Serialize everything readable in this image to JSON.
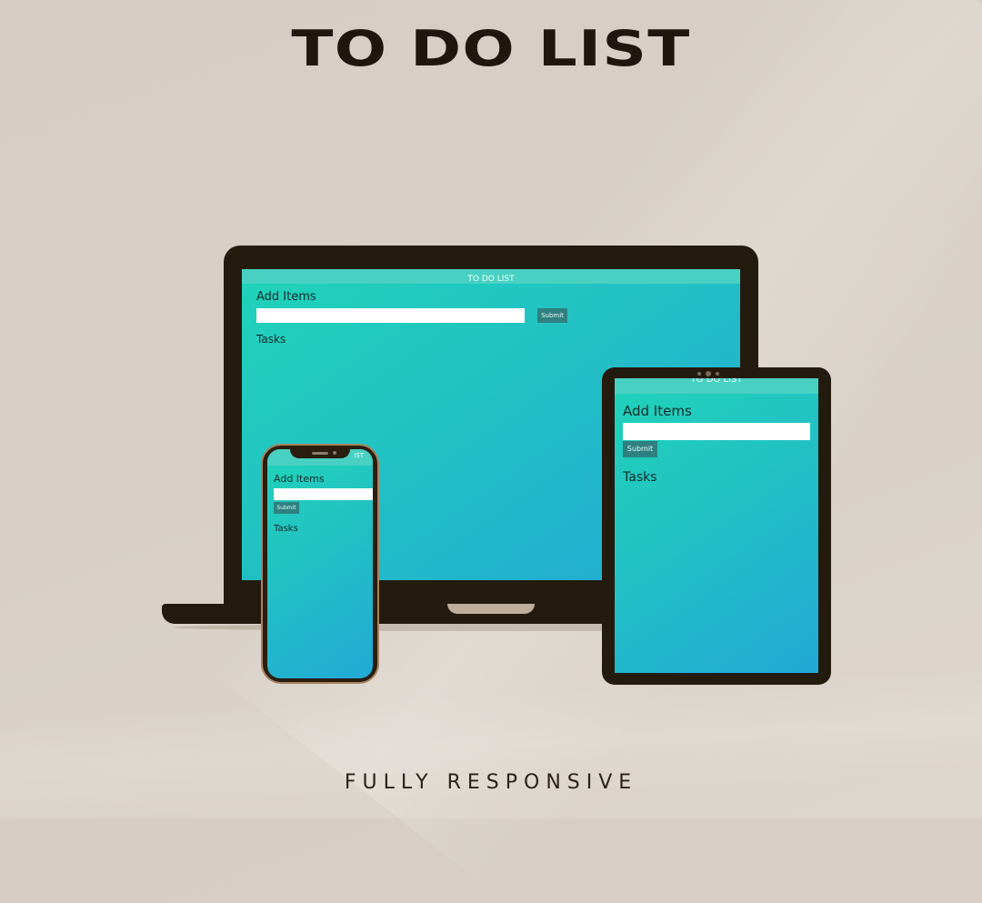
{
  "headline": "TO DO LIST",
  "footer": "FULLY RESPONSIVE",
  "app": {
    "bar_title": "TO DO LIST",
    "add_heading": "Add Items",
    "submit_label": "Submit",
    "tasks_heading": "Tasks",
    "input_value": ""
  },
  "phone_bar_fragment": "IST",
  "colors": {
    "background": "#d6cec5",
    "gradient_start": "#20d3b8",
    "gradient_end": "#21a9d6",
    "app_bar": "#48d1c2",
    "submit_button": "#2f8080",
    "device_frame": "#241b0f",
    "text_dark": "#1f170f"
  }
}
